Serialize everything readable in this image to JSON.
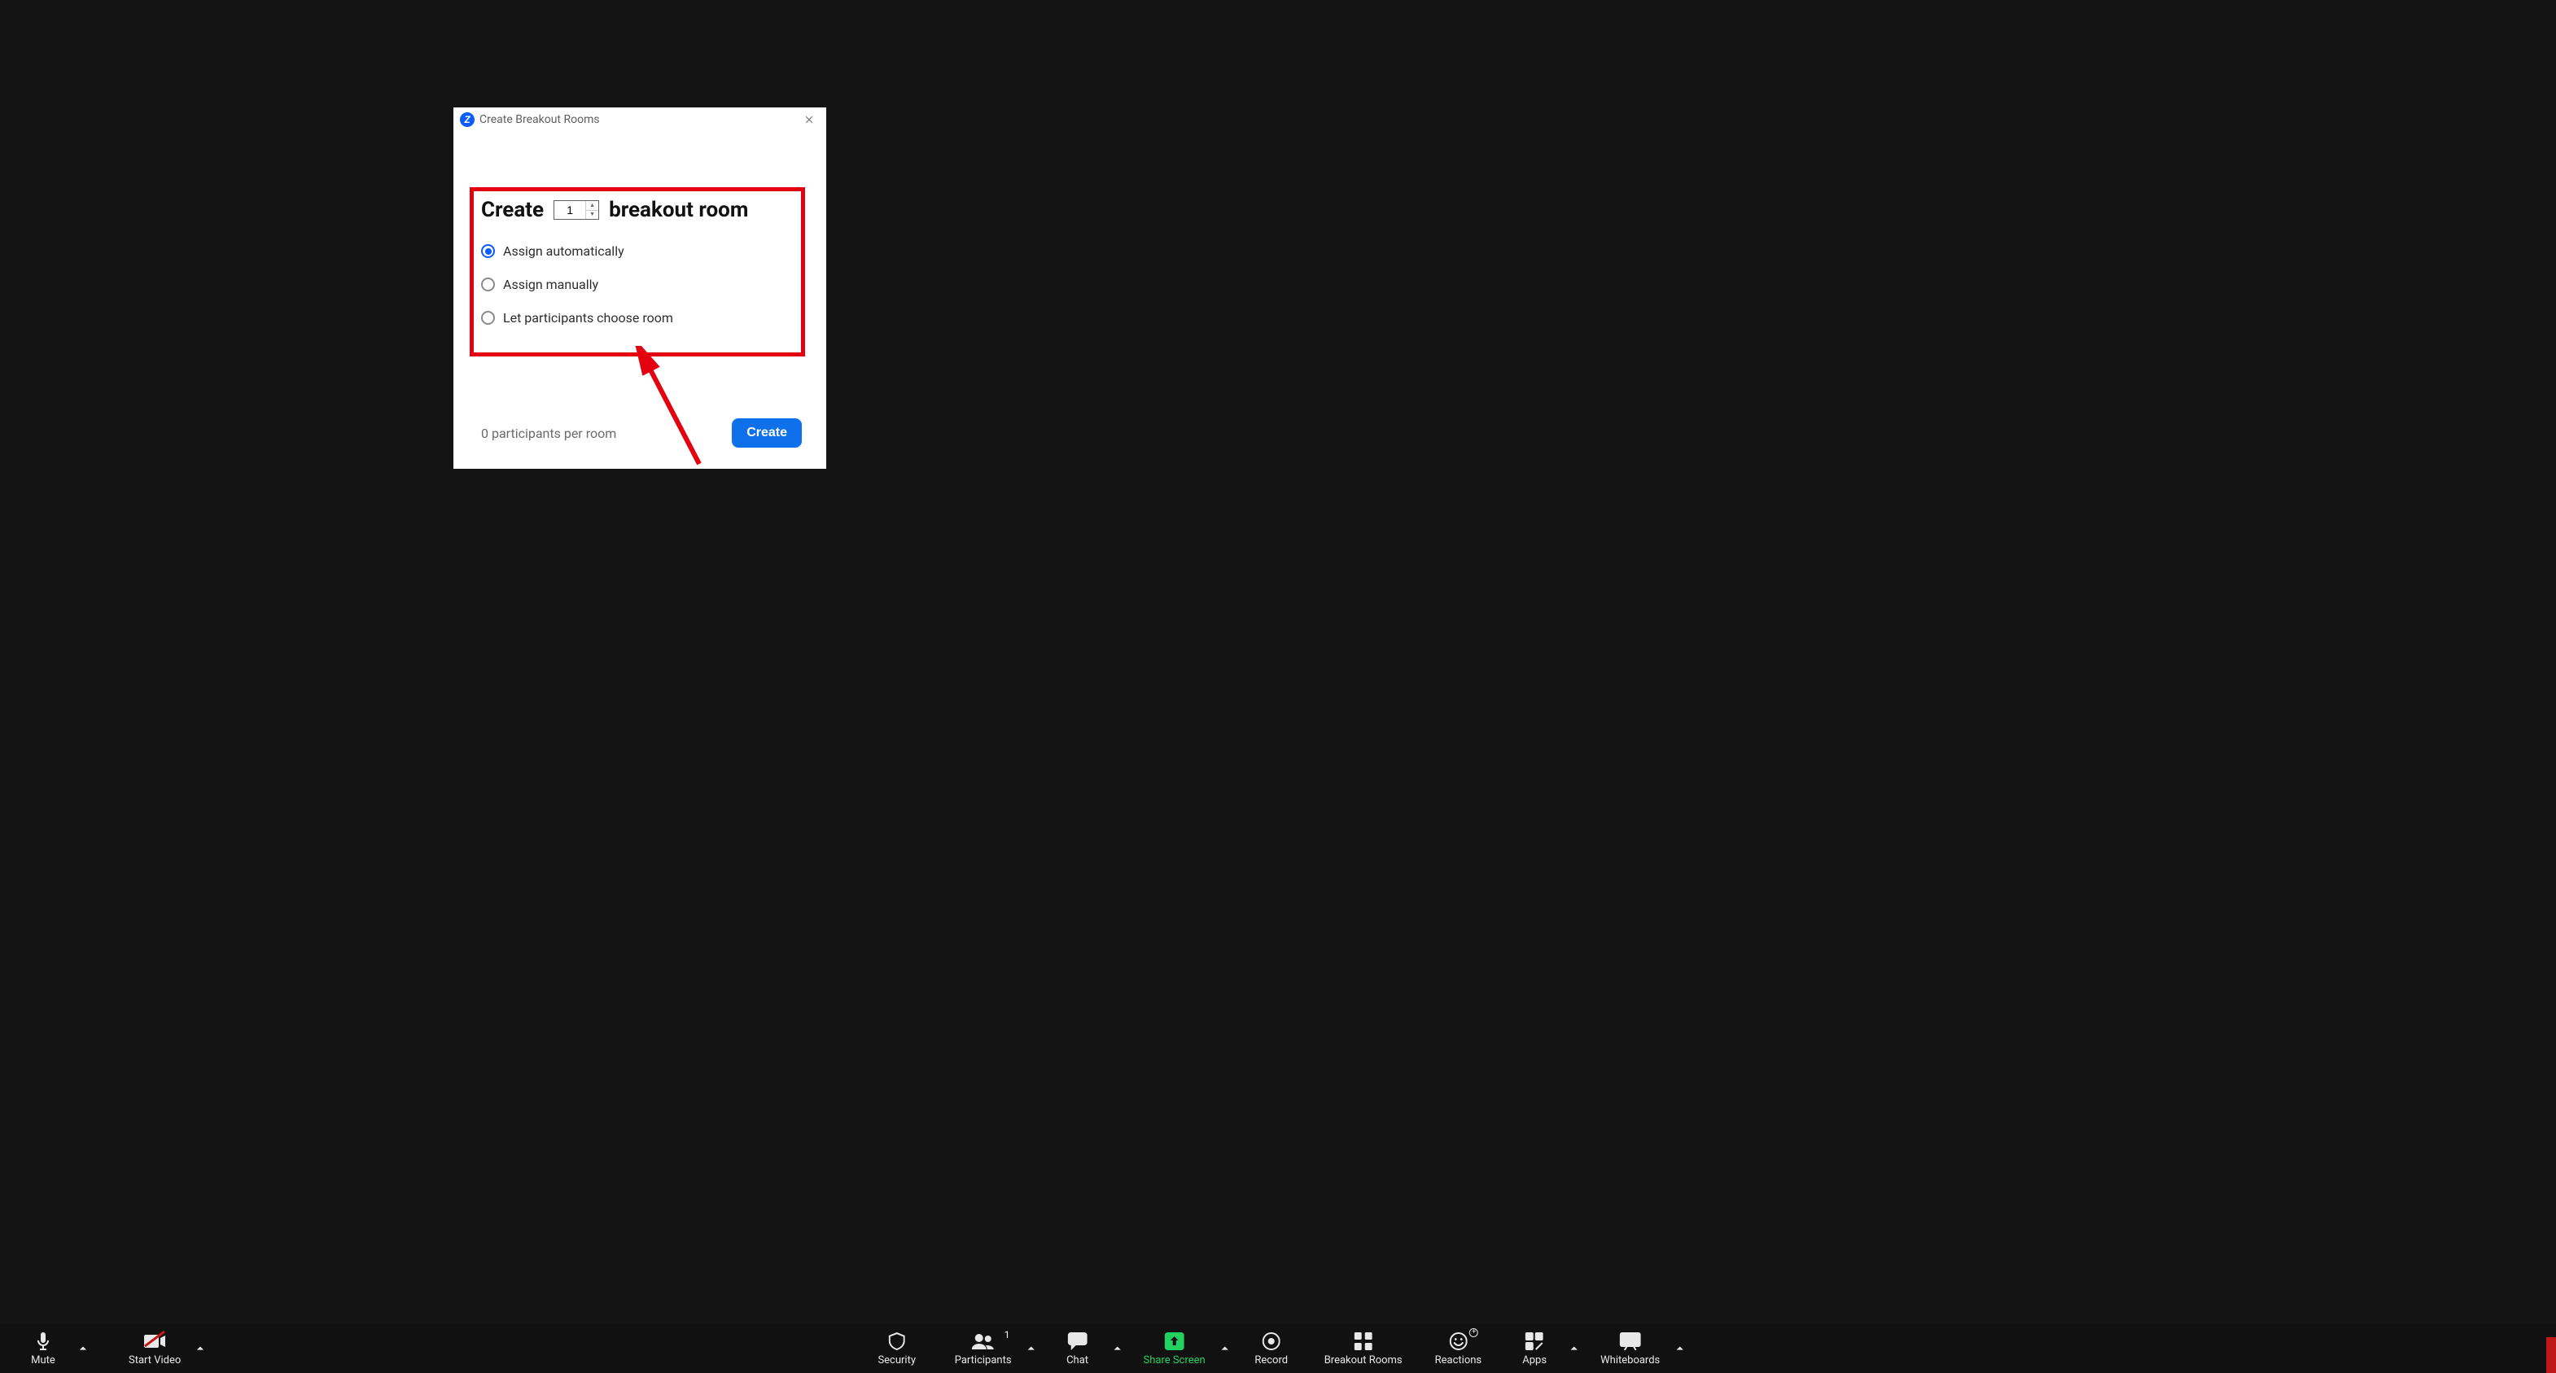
{
  "dialog": {
    "title": "Create Breakout Rooms",
    "create_word": "Create",
    "count_value": "1",
    "breakout_word": "breakout room",
    "options": {
      "auto": "Assign automatically",
      "manual": "Assign manually",
      "choose": "Let participants choose room"
    },
    "selected_option": "auto",
    "footer_status": "0 participants per room",
    "create_button": "Create"
  },
  "toolbar": {
    "mute": "Mute",
    "start_video": "Start Video",
    "security": "Security",
    "participants": "Participants",
    "participants_count": "1",
    "chat": "Chat",
    "share_screen": "Share Screen",
    "record": "Record",
    "breakout_rooms": "Breakout Rooms",
    "reactions": "Reactions",
    "apps": "Apps",
    "whiteboards": "Whiteboards"
  },
  "colors": {
    "accent": "#0b5cff",
    "share": "#23d160",
    "annotation": "#e3000f"
  }
}
